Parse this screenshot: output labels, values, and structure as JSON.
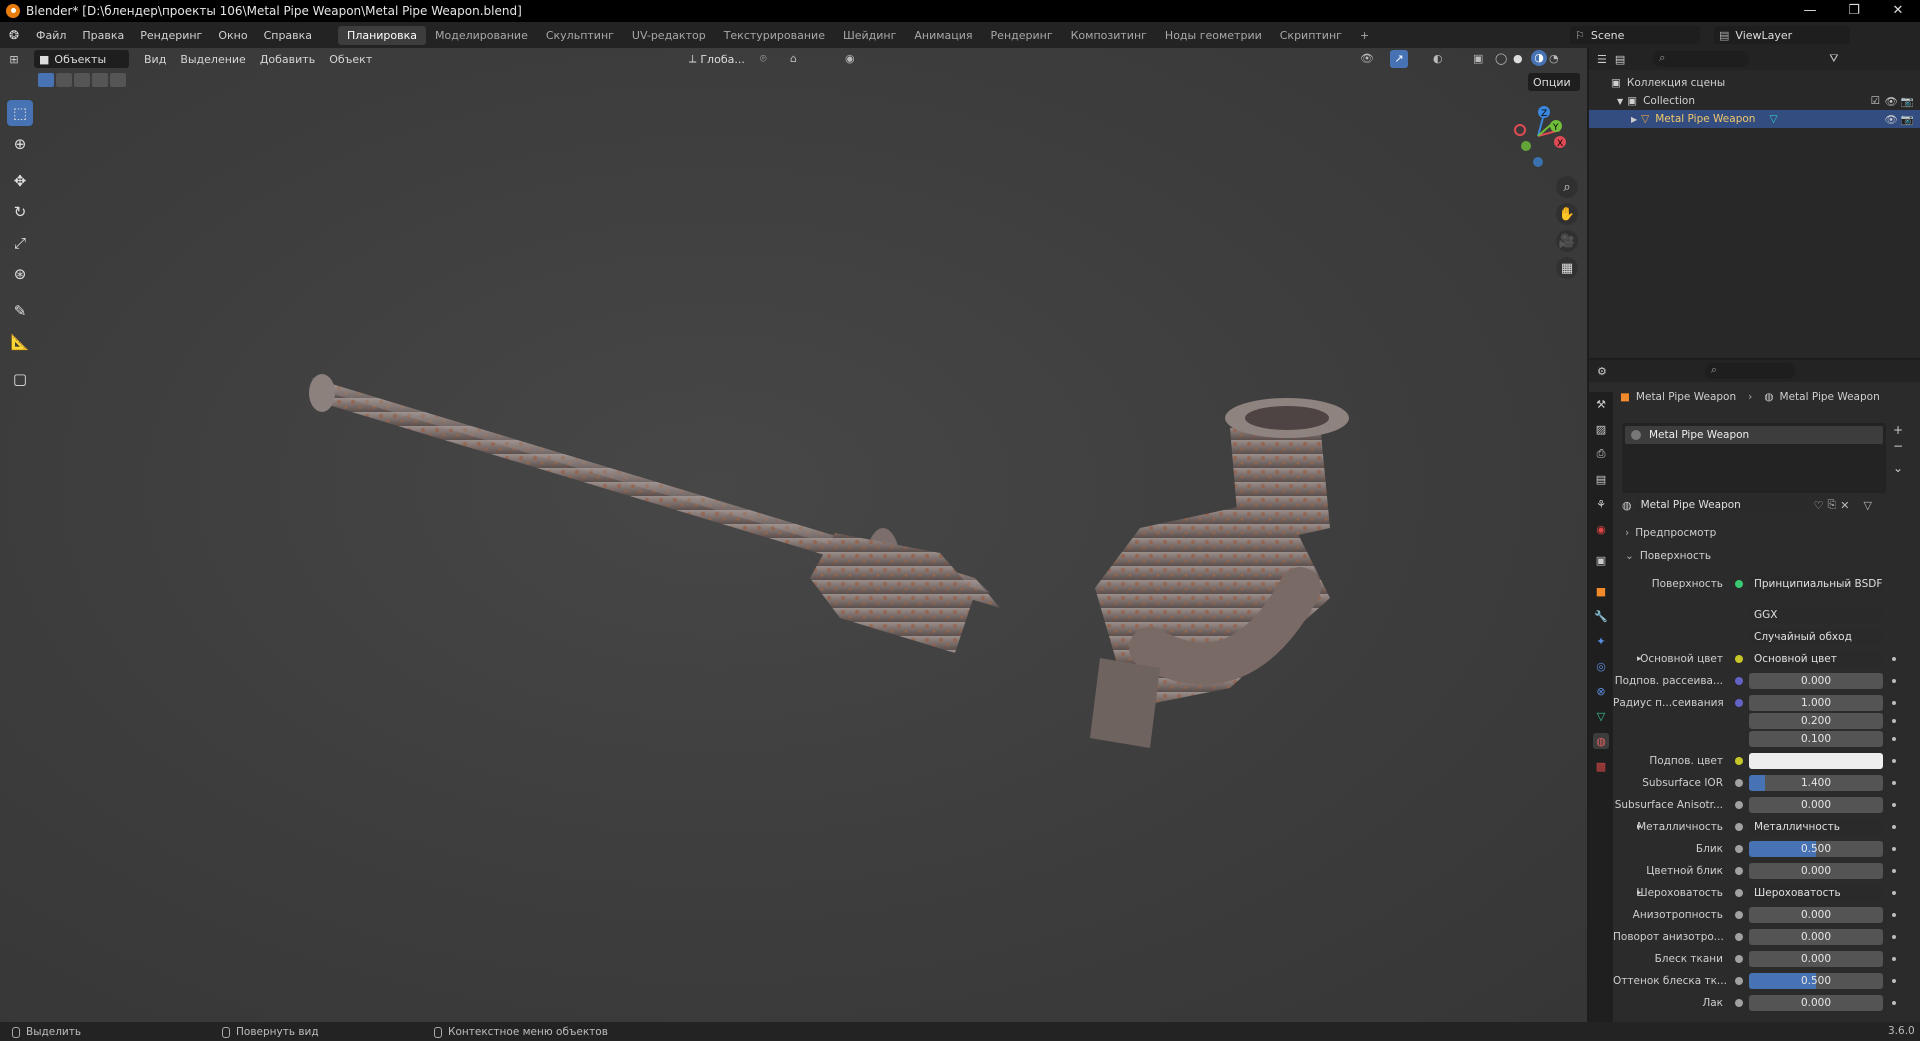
{
  "titlebar": {
    "title": "Blender* [D:\\блендер\\проекты 106\\Metal Pipe Weapon\\Metal Pipe Weapon.blend]"
  },
  "menu": {
    "items": [
      "Файл",
      "Правка",
      "Рендеринг",
      "Окно",
      "Справка"
    ]
  },
  "workspaces": [
    "Планировка",
    "Моделирование",
    "Скульптинг",
    "UV-редактор",
    "Текстурирование",
    "Шейдинг",
    "Анимация",
    "Рендеринг",
    "Композитинг",
    "Ноды геометрии",
    "Скриптинг"
  ],
  "workspace_add": "+",
  "scene": {
    "name": "Scene",
    "viewlayer": "ViewLayer"
  },
  "viewport": {
    "mode": "Объекты",
    "menus": [
      "Вид",
      "Выделение",
      "Добавить",
      "Объект"
    ],
    "orientation": "Глоба...",
    "options_label": "Опции",
    "gizmo": {
      "x": "X",
      "y": "Y",
      "z": "Z"
    }
  },
  "outliner": {
    "scene_collection": "Коллекция сцены",
    "collection": "Collection",
    "object": "Metal Pipe Weapon"
  },
  "properties": {
    "breadcrumb_object": "Metal Pipe Weapon",
    "breadcrumb_material": "Metal Pipe Weapon",
    "slot_name": "Metal Pipe Weapon",
    "material_name": "Metal Pipe Weapon",
    "panel_preview": "Предпросмотр",
    "panel_surface": "Поверхность",
    "surface_label": "Поверхность",
    "surface_value": "Принципиальный BSDF",
    "distribution": "GGX",
    "subsurface_method": "Случайный обход",
    "rows": [
      {
        "label": "Основной цвет",
        "value": "Основной цвет",
        "type": "link",
        "dot": "#c7c729",
        "expand": true
      },
      {
        "label": "Подпов. рассеива...",
        "value": "0.000",
        "type": "num",
        "dot": "#6363c7",
        "fill": 0
      },
      {
        "label": "Радиус п...сеивания",
        "value": "1.000",
        "type": "num",
        "dot": "#6363c7",
        "fill": 0
      },
      {
        "label": "",
        "value": "0.200",
        "type": "num",
        "dot": "",
        "fill": 0
      },
      {
        "label": "",
        "value": "0.100",
        "type": "num",
        "dot": "",
        "fill": 0
      },
      {
        "label": "Подпов. цвет",
        "value": "",
        "type": "color",
        "dot": "#c7c729"
      },
      {
        "label": "Subsurface IOR",
        "value": "1.400",
        "type": "num",
        "dot": "#a1a1a1",
        "fill": 0.12
      },
      {
        "label": "Subsurface Anisotr...",
        "value": "0.000",
        "type": "num",
        "dot": "#a1a1a1",
        "fill": 0
      },
      {
        "label": "Металличность",
        "value": "Металличность",
        "type": "link",
        "dot": "#a1a1a1",
        "expand": true
      },
      {
        "label": "Блик",
        "value": "0.500",
        "type": "num",
        "dot": "#a1a1a1",
        "fill": 0.5
      },
      {
        "label": "Цветной блик",
        "value": "0.000",
        "type": "num",
        "dot": "#a1a1a1",
        "fill": 0
      },
      {
        "label": "Шероховатость",
        "value": "Шероховатость",
        "type": "link",
        "dot": "#a1a1a1",
        "expand": true
      },
      {
        "label": "Анизотропность",
        "value": "0.000",
        "type": "num",
        "dot": "#a1a1a1",
        "fill": 0
      },
      {
        "label": "Поворот анизотро...",
        "value": "0.000",
        "type": "num",
        "dot": "#a1a1a1",
        "fill": 0
      },
      {
        "label": "Блеск ткани",
        "value": "0.000",
        "type": "num",
        "dot": "#a1a1a1",
        "fill": 0
      },
      {
        "label": "Оттенок блеска тк...",
        "value": "0.500",
        "type": "num",
        "dot": "#a1a1a1",
        "fill": 0.5
      },
      {
        "label": "Лак",
        "value": "0.000",
        "type": "num",
        "dot": "#a1a1a1",
        "fill": 0
      }
    ]
  },
  "statusbar": {
    "select": "Выделить",
    "rotate": "Повернуть вид",
    "context": "Контекстное меню объектов",
    "version": "3.6.0"
  },
  "colors": {
    "accent": "#4772b3",
    "header": "#232323",
    "panel": "#2b2b2b",
    "viewport": "#3d3d3d"
  }
}
